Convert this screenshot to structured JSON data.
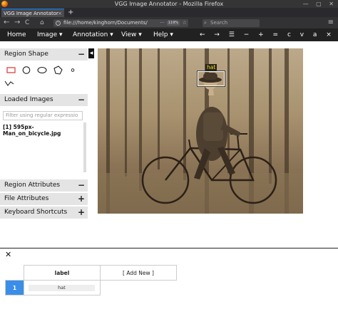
{
  "browser": {
    "window_title": "VGG Image Annotator - Mozilla Firefox",
    "tab_title": "VGG Image Annotator",
    "tab_close": "×",
    "new_tab": "+",
    "back": "←",
    "forward": "→",
    "reload": "C",
    "url": "file:///home/kinghorn/Documents/",
    "url_more": "···",
    "zoom": "119%",
    "search_placeholder": "Search",
    "window_controls": "— ▢ ✕"
  },
  "menubar": {
    "items": [
      "Home",
      "Image ▾",
      "Annotation ▾",
      "View ▾",
      "Help ▾"
    ],
    "tools": "← → ☰   − + =   c v a ×"
  },
  "left_panel": {
    "region_shape": {
      "title": "Region Shape",
      "toggle": "−"
    },
    "loaded_images": {
      "title": "Loaded Images",
      "toggle": "−"
    },
    "filter_placeholder": "Filter using regular expressio",
    "images": [
      "[1] 595px-Man_on_bicycle.jpg"
    ],
    "region_attributes": {
      "title": "Region Attributes",
      "toggle": "−"
    },
    "file_attributes": {
      "title": "File Attributes",
      "toggle": "+"
    },
    "keyboard_shortcuts": {
      "title": "Keyboard Shortcuts",
      "toggle": "+"
    },
    "collapse": "◀"
  },
  "canvas": {
    "region_label": "hat"
  },
  "annotation_panel": {
    "close": "✕",
    "column_header": "label",
    "add_new": "[ Add New ]",
    "rows": [
      {
        "index": "1",
        "label": "hat"
      }
    ]
  },
  "colors": {
    "menubar_bg": "#212121",
    "selected_row": "#3b8ee8",
    "region_label_text": "#ffe000"
  }
}
